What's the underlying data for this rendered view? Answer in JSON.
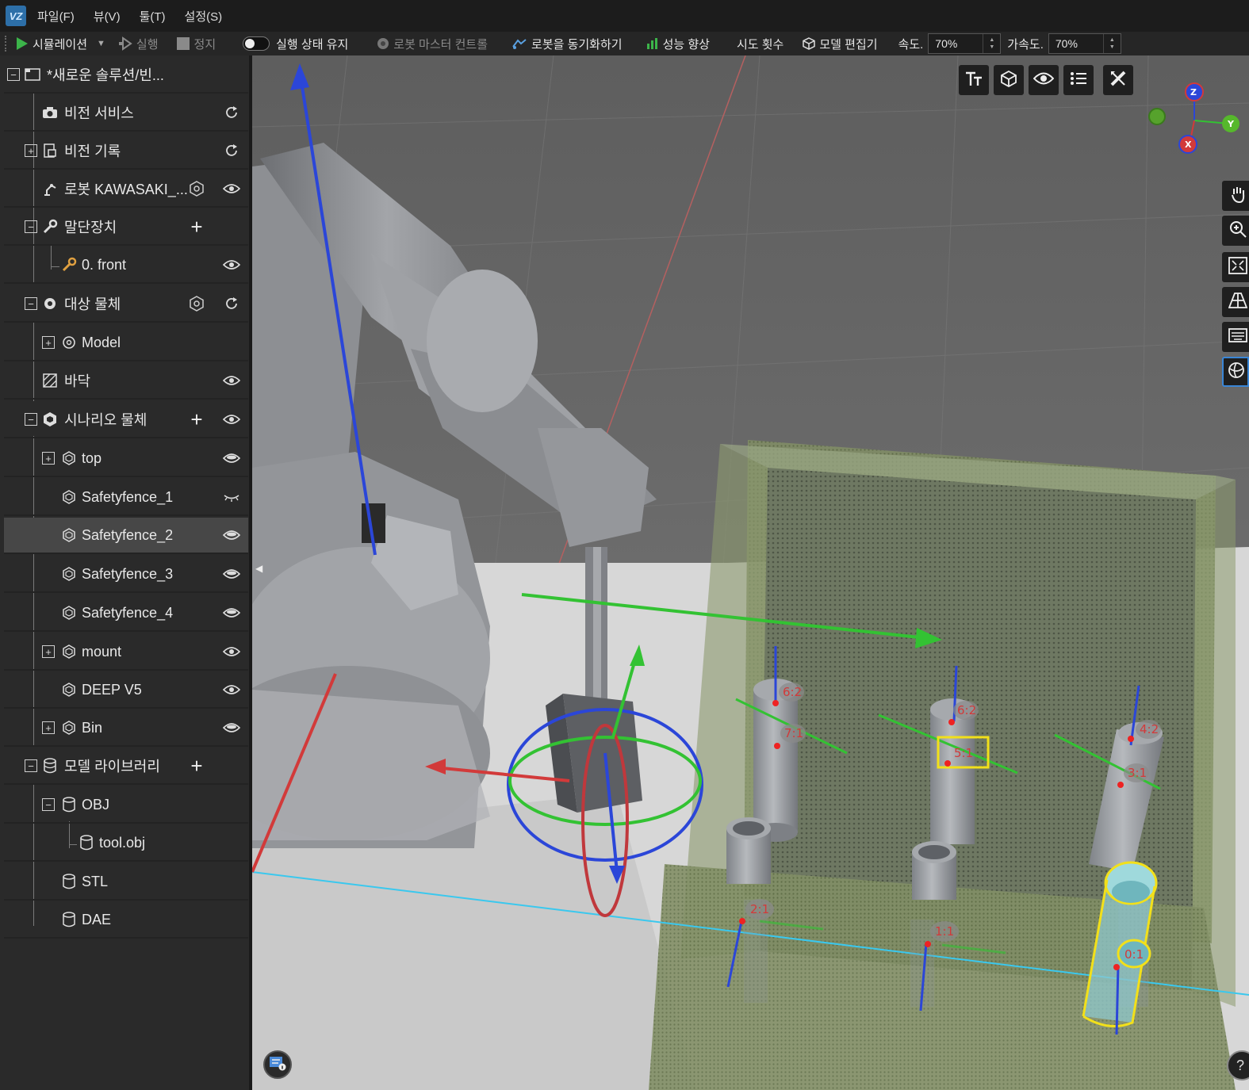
{
  "app": {
    "logo_text": "VZ",
    "menus": [
      "파일(F)",
      "뷰(V)",
      "툴(T)",
      "설정(S)"
    ]
  },
  "toolbar": {
    "simulation": "시뮬레이션",
    "run": "실행",
    "stop": "정지",
    "keep_running_state": "실행 상태 유지",
    "robot_master_control": "로봇 마스터 컨트롤",
    "sync_robot": "로봇을 동기화하기",
    "performance": "성능 향상",
    "attempts": "시도 횟수",
    "model_editor": "모델 편집기",
    "speed_label": "속도.",
    "speed_value": "70%",
    "accel_label": "가속도.",
    "accel_value": "70%"
  },
  "tree": {
    "root": "*새로운 솔루션/빈...",
    "vision_service": "비전 서비스",
    "vision_record": "비전 기록",
    "robot": "로봇 KAWASAKI_...",
    "end_effector": "말단장치",
    "end_effector_front": "0. front",
    "target_object": "대상 물체",
    "target_model": "Model",
    "floor": "바닥",
    "scenario_objects": "시나리오 물체",
    "scenario_items": [
      {
        "label": "top",
        "expandable": true,
        "visibility": "visible"
      },
      {
        "label": "Safetyfence_1",
        "expandable": false,
        "visibility": "hidden"
      },
      {
        "label": "Safetyfence_2",
        "expandable": false,
        "visibility": "visible",
        "selected": true
      },
      {
        "label": "Safetyfence_3",
        "expandable": false,
        "visibility": "visible"
      },
      {
        "label": "Safetyfence_4",
        "expandable": false,
        "visibility": "visible"
      },
      {
        "label": "mount",
        "expandable": true,
        "visibility": "visible"
      },
      {
        "label": "DEEP V5",
        "expandable": false,
        "visibility": "visible"
      },
      {
        "label": "Bin",
        "expandable": true,
        "visibility": "visible"
      }
    ],
    "model_library": "모델 라이브러리",
    "library_obj": "OBJ",
    "library_tool_obj": "tool.obj",
    "library_stl": "STL",
    "library_dae": "DAE"
  },
  "viewport": {
    "gizmo_labels": {
      "z": "Z",
      "y": "Y",
      "x": "X"
    },
    "pick_labels": [
      "6:2",
      "7:1",
      "6:2",
      "5:1",
      "4:2",
      "3:1",
      "2:1",
      "1:1",
      "0:1"
    ],
    "help": "?"
  },
  "colors": {
    "axis_x": "#d23a3a",
    "axis_y": "#33c233",
    "axis_z": "#2b46d8",
    "highlight": "#f2e01a",
    "selection_bg": "#474747"
  }
}
